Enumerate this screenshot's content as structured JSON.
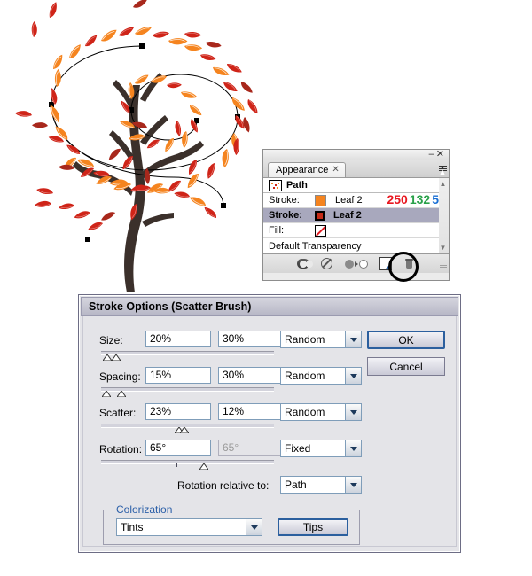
{
  "artwork": {
    "name": "autumn-tree-illustration",
    "description": "Vector tree with spiral scatter-brush path of orange and red leaves",
    "trunk_color": "#3b302b",
    "leaf_orange": "#f5841f",
    "leaf_red": "#cf2418",
    "leaf_dark_red": "#a8281c",
    "path_stroke": "#000000"
  },
  "appearance_panel": {
    "tab_label": "Appearance",
    "tab_close_glyph": "✕",
    "minimize_glyph": "–",
    "close_glyph": "✕",
    "header_row": {
      "label": "Path",
      "icon": "path-thumbnail-icon"
    },
    "rows": [
      {
        "label": "Stroke:",
        "swatch": "orange",
        "brush": "Leaf 2",
        "selected": false,
        "rgb": {
          "r": "250",
          "g": "132",
          "b": "5"
        }
      },
      {
        "label": "Stroke:",
        "swatch": "red",
        "brush": "Leaf 2",
        "selected": true,
        "rgb": null
      },
      {
        "label": "Fill:",
        "swatch": "none",
        "brush": "",
        "selected": false,
        "rgb": null
      },
      {
        "label": "Default Transparency",
        "swatch": null,
        "brush": "",
        "selected": false,
        "rgb": null
      }
    ],
    "footer_buttons": [
      {
        "name": "toggle-visibility-button",
        "label": ""
      },
      {
        "name": "clear-appearance-button",
        "label": ""
      },
      {
        "name": "reduce-to-basic-appearance-button",
        "label": ""
      },
      {
        "name": "duplicate-selected-item-button",
        "label": ""
      },
      {
        "name": "delete-selected-item-button",
        "label": ""
      }
    ],
    "highlight_note": "circle highlight around duplicate-selected-item-button"
  },
  "stroke_dialog": {
    "title": "Stroke Options (Scatter Brush)",
    "fields": [
      {
        "label": "Size:",
        "min_value": "20%",
        "max_value": "30%",
        "max_disabled": false,
        "mode": "Random"
      },
      {
        "label": "Spacing:",
        "min_value": "15%",
        "max_value": "30%",
        "max_disabled": false,
        "mode": "Random"
      },
      {
        "label": "Scatter:",
        "min_value": "23%",
        "max_value": "12%",
        "max_disabled": false,
        "mode": "Random"
      },
      {
        "label": "Rotation:",
        "min_value": "65°",
        "max_value": "65°",
        "max_disabled": true,
        "mode": "Fixed"
      }
    ],
    "rotation_relative_label": "Rotation relative to:",
    "rotation_relative_value": "Path",
    "colorization": {
      "group_label": "Colorization",
      "method_value": "Tints",
      "tips_label": "Tips"
    },
    "ok_label": "OK",
    "cancel_label": "Cancel",
    "accent_color": "#2b5f9e"
  }
}
